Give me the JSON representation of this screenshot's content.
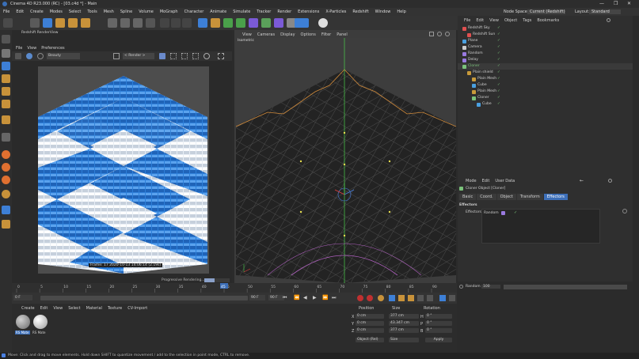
{
  "window": {
    "title": "Cinema 4D R23.000 (RC) - [03.c4d *] - Main",
    "controls": [
      "—",
      "❐",
      "✕"
    ]
  },
  "menubar": {
    "items": [
      "File",
      "Edit",
      "Create",
      "Modes",
      "Select",
      "Tools",
      "Mesh",
      "Spline",
      "Volume",
      "MoGraph",
      "Character",
      "Animate",
      "Simulate",
      "Tracker",
      "Render",
      "Extensions",
      "X-Particles",
      "Redshift",
      "Window",
      "Help"
    ],
    "node_space_label": "Node Space:",
    "node_space_value": "Current (Redshift)",
    "layout_label": "Layout:",
    "layout_value": "Standard"
  },
  "render_view": {
    "title": "Redshift RenderView",
    "menu": [
      "File",
      "View",
      "Preferences"
    ],
    "mode": "Beauty",
    "render_dropdown": "< Render >",
    "caption": "Frame: 17  2020-10-13  14:06:14  (2.19s)",
    "progress_label": "Progressive Rendering...",
    "progress": 0.4
  },
  "viewport": {
    "menu": [
      "View",
      "Cameras",
      "Display",
      "Options",
      "Filter",
      "Panel"
    ],
    "camera_label": "Isometric"
  },
  "object_manager": {
    "menu": [
      "File",
      "Edit",
      "View",
      "Object",
      "Tags",
      "Bookmarks"
    ],
    "objects": [
      {
        "name": "Redshift Sky",
        "indent": 0,
        "color": "#e05050",
        "highlight": false
      },
      {
        "name": "Redshift Sun",
        "indent": 1,
        "color": "#e05050",
        "highlight": false
      },
      {
        "name": "Plane",
        "indent": 0,
        "color": "#4aa0e0",
        "highlight": false
      },
      {
        "name": "Camera",
        "indent": 0,
        "color": "#cccccc",
        "highlight": false
      },
      {
        "name": "Random",
        "indent": 0,
        "color": "#9a7ae0",
        "highlight": false
      },
      {
        "name": "Delay",
        "indent": 0,
        "color": "#9a7ae0",
        "highlight": false
      },
      {
        "name": "Cloner",
        "indent": 0,
        "color": "#7ac27a",
        "highlight": true
      },
      {
        "name": "Plain shield",
        "indent": 1,
        "color": "#c89a3a",
        "highlight": false
      },
      {
        "name": "Plain Mesh",
        "indent": 2,
        "color": "#c89a3a",
        "highlight": false
      },
      {
        "name": "Cube",
        "indent": 2,
        "color": "#4aa0e0",
        "highlight": false
      },
      {
        "name": "Plain Mesh",
        "indent": 2,
        "color": "#c89a3a",
        "highlight": false
      },
      {
        "name": "Cloner",
        "indent": 2,
        "color": "#7ac27a",
        "highlight": false
      },
      {
        "name": "Cube",
        "indent": 3,
        "color": "#4aa0e0",
        "highlight": false
      }
    ]
  },
  "attributes": {
    "menu": [
      "Mode",
      "Edit",
      "User Data"
    ],
    "object_title": "Cloner Object [Cloner]",
    "tabs": [
      "Basic",
      "Coord.",
      "Object",
      "Transform",
      "Effectors"
    ],
    "active_tab": "Effectors",
    "section": "Effectors",
    "effectors_label": "Effectors",
    "effector_item": "Random",
    "random_label": "Random",
    "random_value": "100"
  },
  "timeline": {
    "ticks": [
      "0",
      "5",
      "10",
      "15",
      "20",
      "25",
      "30",
      "35",
      "40",
      "45",
      "50",
      "55",
      "60",
      "65",
      "70",
      "75",
      "80",
      "85",
      "90"
    ],
    "current_frame": "0 F",
    "start": "0 F",
    "end_field": "90 F",
    "end_field2": "90 F",
    "current_marker": "45",
    "current_value": 45,
    "frame_range": [
      0,
      90
    ]
  },
  "materials": {
    "menu": [
      "Create",
      "Edit",
      "View",
      "Select",
      "Material",
      "Texture",
      "CV-Import"
    ],
    "items": [
      {
        "label": "RS Mate",
        "color": "#9a9a9a"
      },
      {
        "label": "RS Mate",
        "color": "#e8e8e8"
      }
    ]
  },
  "coordinates": {
    "headers": [
      "Position",
      "Size",
      "Rotation"
    ],
    "rows": [
      {
        "axis": "X",
        "pos": "0 cm",
        "size": "377 cm",
        "rot_axis": "H",
        "rot": "0 °"
      },
      {
        "axis": "Y",
        "pos": "0 cm",
        "size": "43.347 cm",
        "rot_axis": "P",
        "rot": "0 °"
      },
      {
        "axis": "Z",
        "pos": "0 cm",
        "size": "377 cm",
        "rot_axis": "B",
        "rot": "0 °"
      }
    ],
    "mode_dropdown": "Object (Rel)",
    "size_dropdown": "Size",
    "apply_label": "Apply"
  },
  "status": {
    "text": "Move: Click and drag to move elements. Hold down SHIFT to quantize movement / add to the selection in point mode, CTRL to remove."
  },
  "colors": {
    "accent_blue": "#3d7fd6",
    "cloner_green": "#7ac27a",
    "active_tab": "#3d6fb8"
  }
}
